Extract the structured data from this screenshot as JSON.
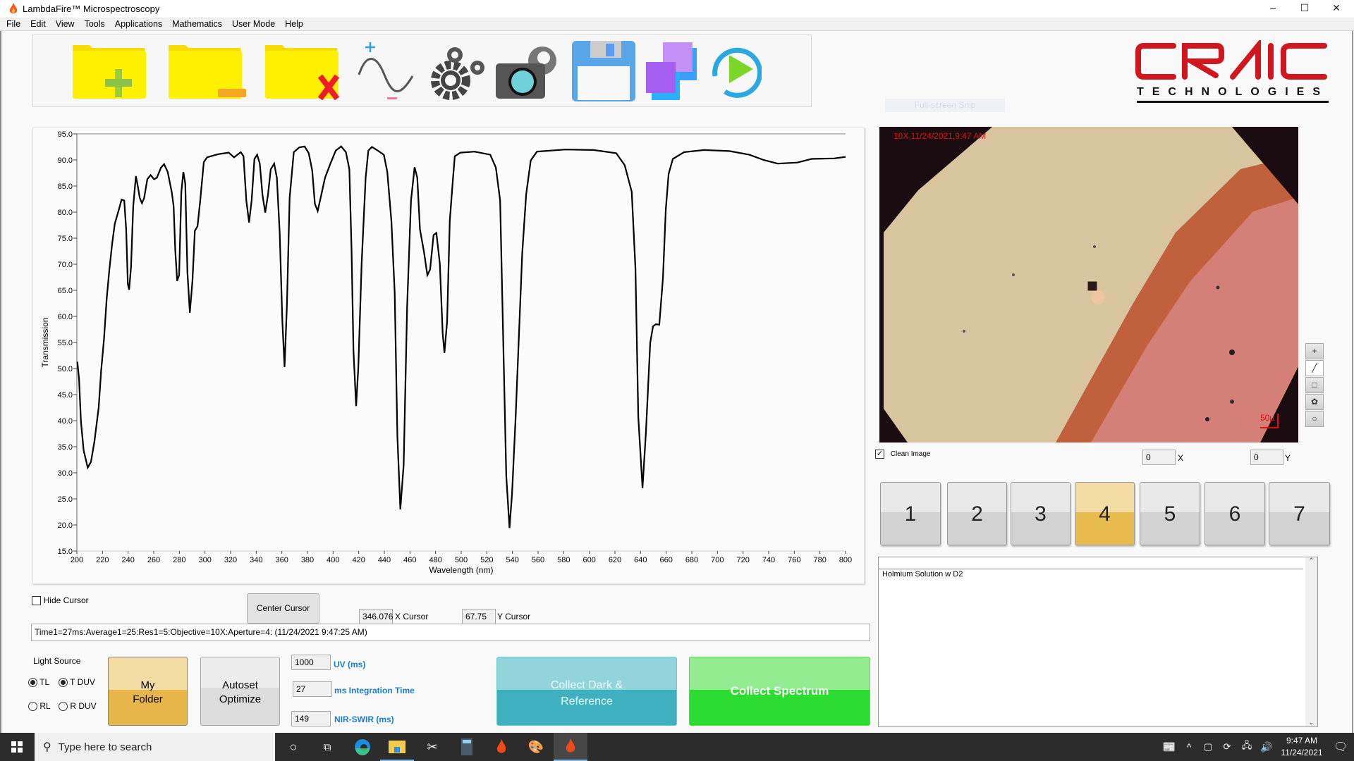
{
  "window": {
    "title": "LambdaFire™ Microspectroscopy",
    "minimize": "–",
    "maximize": "☐",
    "close": "✕"
  },
  "menu": {
    "items": [
      "File",
      "Edit",
      "View",
      "Tools",
      "Applications",
      "Mathematics",
      "User Mode",
      "Help"
    ]
  },
  "toolbar": {
    "icons": [
      "new-folder-icon",
      "folder-minus-icon",
      "delete-folder-icon",
      "sine-wave-icon",
      "settings-gears-icon",
      "camera-settings-icon",
      "save-floppy-icon",
      "overlay-squares-icon",
      "play-icon"
    ]
  },
  "logo": {
    "main": "CRAIC",
    "sub": "TECHNOLOGIES",
    "color": "#d0161f"
  },
  "snip": {
    "label": "Full-screen Snip"
  },
  "chart_data": {
    "type": "line",
    "xlabel": "Wavelength (nm)",
    "ylabel": "Transmission",
    "xlim": [
      200,
      800
    ],
    "ylim": [
      15,
      95
    ],
    "xticks": [
      "200",
      "220",
      "240",
      "260",
      "280",
      "300",
      "320",
      "340",
      "360",
      "380",
      "400",
      "420",
      "440",
      "460",
      "480",
      "500",
      "520",
      "540",
      "560",
      "580",
      "600",
      "620",
      "640",
      "660",
      "680",
      "700",
      "720",
      "740",
      "760",
      "780",
      "800"
    ],
    "yticks": [
      "15.0",
      "20.0",
      "25.0",
      "30.0",
      "35.0",
      "40.0",
      "45.0",
      "50.0",
      "55.0",
      "60.0",
      "65.0",
      "70.0",
      "75.0",
      "80.0",
      "85.0",
      "90.0",
      "95.0"
    ],
    "grid": false,
    "line_color": "#000000",
    "points": [
      [
        200.4,
        51.3
      ],
      [
        201.7,
        48.0
      ],
      [
        203.2,
        39.8
      ],
      [
        205.3,
        34.3
      ],
      [
        208.5,
        31.0
      ],
      [
        211,
        32.1
      ],
      [
        213.7,
        36
      ],
      [
        217,
        42.5
      ],
      [
        219,
        49.7
      ],
      [
        221.2,
        55.7
      ],
      [
        223.3,
        63.4
      ],
      [
        225.4,
        69
      ],
      [
        227.5,
        73.9
      ],
      [
        229.6,
        77.8
      ],
      [
        232.8,
        80.5
      ],
      [
        234.9,
        82.4
      ],
      [
        237,
        82.2
      ],
      [
        238.5,
        76.7
      ],
      [
        239.8,
        66.2
      ],
      [
        240.8,
        65.1
      ],
      [
        242.3,
        69.5
      ],
      [
        244,
        81.1
      ],
      [
        246.1,
        86.9
      ],
      [
        247.6,
        84.9
      ],
      [
        249.1,
        82.7
      ],
      [
        250.8,
        81.7
      ],
      [
        252.5,
        82.7
      ],
      [
        255,
        86.3
      ],
      [
        257.6,
        87.1
      ],
      [
        260.3,
        86.3
      ],
      [
        262.5,
        86.6
      ],
      [
        265.6,
        88.5
      ],
      [
        268.1,
        89.2
      ],
      [
        270.9,
        87.7
      ],
      [
        274.1,
        83.8
      ],
      [
        275.5,
        81.1
      ],
      [
        276.8,
        72.8
      ],
      [
        278.3,
        66.8
      ],
      [
        279.8,
        67.9
      ],
      [
        281.5,
        83.8
      ],
      [
        283.1,
        87.7
      ],
      [
        284.6,
        85.5
      ],
      [
        286.3,
        68.4
      ],
      [
        288.2,
        60.7
      ],
      [
        290.2,
        66.8
      ],
      [
        292.1,
        76.4
      ],
      [
        294.2,
        77.3
      ],
      [
        296.3,
        82.2
      ],
      [
        299.1,
        89.6
      ],
      [
        301.6,
        90.5
      ],
      [
        310,
        91.1
      ],
      [
        318.5,
        91.4
      ],
      [
        322.7,
        90.5
      ],
      [
        328,
        91.5
      ],
      [
        330.1,
        90.7
      ],
      [
        332.3,
        82.2
      ],
      [
        334.4,
        78
      ],
      [
        336.4,
        82.2
      ],
      [
        338.6,
        90.2
      ],
      [
        340.7,
        91
      ],
      [
        342.8,
        89.3
      ],
      [
        344.9,
        83.3
      ],
      [
        347,
        79.9
      ],
      [
        349.2,
        83.3
      ],
      [
        351.3,
        88.2
      ],
      [
        354,
        89.3
      ],
      [
        356.1,
        86.6
      ],
      [
        358.3,
        76.1
      ],
      [
        360.4,
        59
      ],
      [
        362.1,
        50.3
      ],
      [
        364,
        62.3
      ],
      [
        366.1,
        82.7
      ],
      [
        369.3,
        91.5
      ],
      [
        373.6,
        92.4
      ],
      [
        377.8,
        92.6
      ],
      [
        381,
        91.3
      ],
      [
        383.7,
        88
      ],
      [
        385.8,
        81.6
      ],
      [
        388,
        80.2
      ],
      [
        390.5,
        83
      ],
      [
        393.7,
        86.6
      ],
      [
        397.9,
        89.3
      ],
      [
        402.1,
        91.8
      ],
      [
        406.3,
        92.6
      ],
      [
        410,
        91.5
      ],
      [
        412.7,
        88.2
      ],
      [
        414.4,
        72.8
      ],
      [
        415.9,
        53.5
      ],
      [
        418,
        42.8
      ],
      [
        419.7,
        50.2
      ],
      [
        422.3,
        70.1
      ],
      [
        425.4,
        86.6
      ],
      [
        427.5,
        91.8
      ],
      [
        430.3,
        92.5
      ],
      [
        434.9,
        91.8
      ],
      [
        439.6,
        91
      ],
      [
        442.3,
        87.7
      ],
      [
        445.5,
        78.3
      ],
      [
        448.1,
        64.5
      ],
      [
        450.2,
        37
      ],
      [
        452.5,
        23
      ],
      [
        455.1,
        31.5
      ],
      [
        457.8,
        61.8
      ],
      [
        460.8,
        82.2
      ],
      [
        463.6,
        88.6
      ],
      [
        465.7,
        86.6
      ],
      [
        467.8,
        76.7
      ],
      [
        471,
        72.3
      ],
      [
        473.6,
        67.9
      ],
      [
        475.7,
        69
      ],
      [
        478.4,
        75.6
      ],
      [
        480.6,
        76
      ],
      [
        483.3,
        70.1
      ],
      [
        485.5,
        56.8
      ],
      [
        486.9,
        53
      ],
      [
        489,
        59
      ],
      [
        491.1,
        78.3
      ],
      [
        493.3,
        85.5
      ],
      [
        495,
        90.7
      ],
      [
        499.4,
        91.4
      ],
      [
        510.5,
        91.6
      ],
      [
        522.7,
        91
      ],
      [
        527.1,
        88.5
      ],
      [
        530.4,
        82.2
      ],
      [
        532.6,
        57.8
      ],
      [
        535.2,
        29.4
      ],
      [
        537.7,
        19.4
      ],
      [
        539.7,
        26
      ],
      [
        542.5,
        40.7
      ],
      [
        547.6,
        72
      ],
      [
        550.7,
        83.4
      ],
      [
        554.3,
        89.9
      ],
      [
        559.1,
        91.6
      ],
      [
        581.2,
        92
      ],
      [
        603.3,
        91.9
      ],
      [
        621,
        91.3
      ],
      [
        627.6,
        89
      ],
      [
        633.1,
        83.9
      ],
      [
        636,
        69.1
      ],
      [
        638.2,
        40.7
      ],
      [
        641.5,
        27.1
      ],
      [
        644.2,
        37.9
      ],
      [
        647.5,
        54.9
      ],
      [
        649.7,
        58.1
      ],
      [
        651.9,
        58.5
      ],
      [
        654.6,
        58.4
      ],
      [
        657.5,
        67.4
      ],
      [
        659.7,
        80.5
      ],
      [
        661.9,
        87.3
      ],
      [
        665.2,
        90.2
      ],
      [
        674,
        91.5
      ],
      [
        689.5,
        91.9
      ],
      [
        709.4,
        91.7
      ],
      [
        724.9,
        91
      ],
      [
        736,
        90
      ],
      [
        747,
        89.3
      ],
      [
        762.4,
        89.5
      ],
      [
        773.5,
        90.2
      ],
      [
        791.2,
        90.3
      ],
      [
        800,
        90.6
      ]
    ]
  },
  "cursor": {
    "hide_label": "Hide Cursor",
    "hide_checked": false,
    "center_label": "Center Cursor",
    "x_value": "346.076",
    "x_label": "X Cursor",
    "y_value": "67.75",
    "y_label": "Y Cursor"
  },
  "status": {
    "text": "Time1=27ms:Average1=25:Res1=5:Objective=10X:Aperture=4: (11/24/2021 9:47:25 AM)"
  },
  "light_source": {
    "label": "Light Source",
    "options": [
      {
        "label": "TL",
        "selected": true
      },
      {
        "label": "T DUV",
        "selected": true
      },
      {
        "label": "RL",
        "selected": false
      },
      {
        "label": "R DUV",
        "selected": false
      }
    ]
  },
  "buttons": {
    "my_folder": "My\nFolder",
    "autoset": "Autoset\nOptimize",
    "collect_dark": "Collect Dark &\nReference",
    "collect_spectrum": "Collect Spectrum"
  },
  "integration": {
    "uv_value": "1000",
    "uv_label": "UV (ms)",
    "int_value": "27",
    "int_label": "ms Integration Time",
    "nir_value": "149",
    "nir_label": "NIR-SWIR (ms)"
  },
  "camera": {
    "overlay": "10X,11/24/2021,9:47 AM",
    "scale_label": "50µ",
    "clean_label": "Clean Image",
    "clean_checked": true,
    "x_value": "0",
    "x_label": "X",
    "y_value": "0",
    "y_label": "Y",
    "tools": [
      "crosshair-tool-icon",
      "line-tool-icon",
      "rectangle-tool-icon",
      "freeform-tool-icon",
      "circle-tool-icon"
    ]
  },
  "slots": {
    "items": [
      "1",
      "2",
      "3",
      "4",
      "5",
      "6",
      "7"
    ],
    "selected": "4"
  },
  "notes": {
    "text": "Holmium Solution w D2"
  },
  "taskbar": {
    "search_placeholder": "Type here to search",
    "time": "9:47 AM",
    "date": "11/24/2021"
  }
}
